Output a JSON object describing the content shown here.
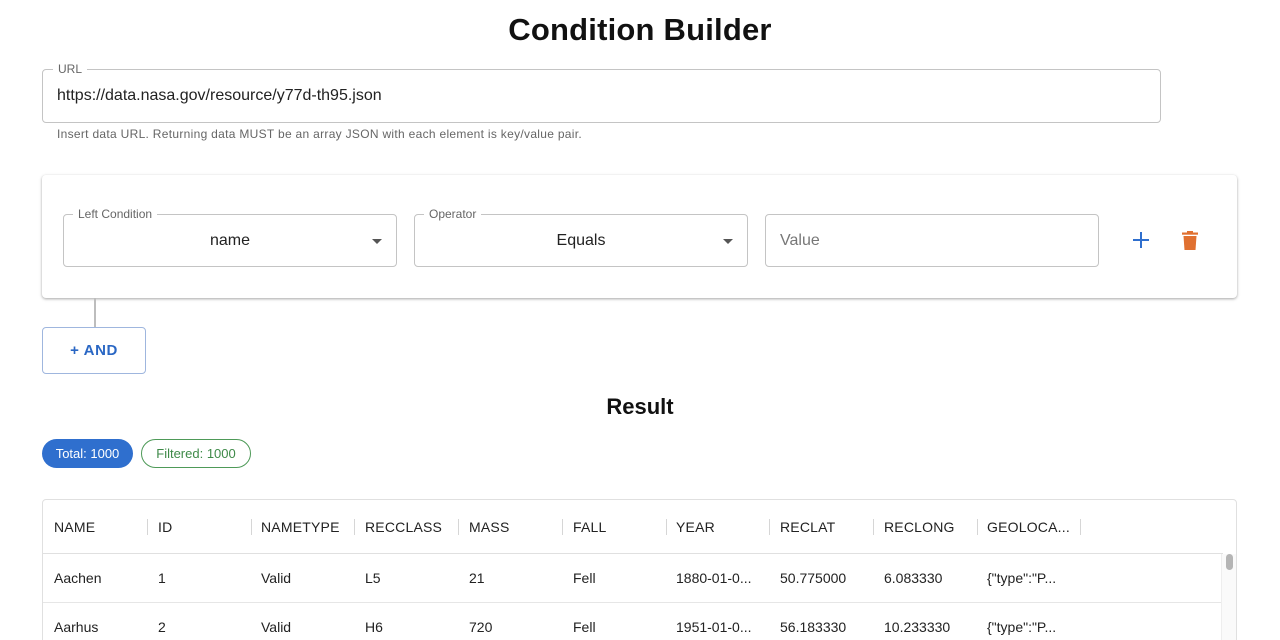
{
  "page": {
    "title": "Condition Builder"
  },
  "url_field": {
    "label": "URL",
    "value": "https://data.nasa.gov/resource/y77d-th95.json",
    "helper": "Insert data URL. Returning data MUST be an array JSON with each element is key/value pair."
  },
  "condition": {
    "left_label": "Left Condition",
    "left_value": "name",
    "operator_label": "Operator",
    "operator_value": "Equals",
    "value_placeholder": "Value",
    "add_icon": "plus-icon",
    "delete_icon": "trash-icon"
  },
  "and_button": {
    "label": "+ AND"
  },
  "result": {
    "title": "Result",
    "total_chip": "Total: 1000",
    "filtered_chip": "Filtered: 1000"
  },
  "colors": {
    "primary": "#2f6fce",
    "delete": "#e07030",
    "filtered": "#3e8a48"
  },
  "table": {
    "columns": [
      "NAME",
      "ID",
      "NAMETYPE",
      "RECCLASS",
      "MASS",
      "FALL",
      "YEAR",
      "RECLAT",
      "RECLONG",
      "GEOLOCA..."
    ],
    "rows": [
      [
        "Aachen",
        "1",
        "Valid",
        "L5",
        "21",
        "Fell",
        "1880-01-0...",
        "50.775000",
        "6.083330",
        "{\"type\":\"P..."
      ],
      [
        "Aarhus",
        "2",
        "Valid",
        "H6",
        "720",
        "Fell",
        "1951-01-0...",
        "56.183330",
        "10.233330",
        "{\"type\":\"P..."
      ]
    ]
  }
}
